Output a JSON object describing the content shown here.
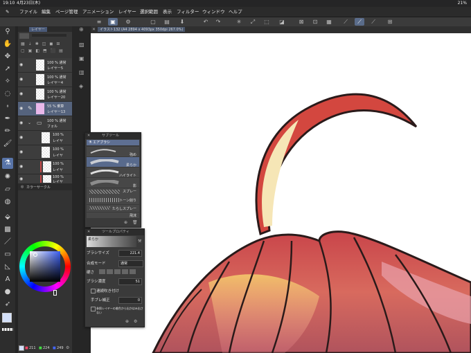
{
  "status": {
    "time": "19:10",
    "date": "4月23日(木)",
    "battery": "21%"
  },
  "menu": [
    "ファイル",
    "編集",
    "ページ管理",
    "アニメーション",
    "レイヤー",
    "選択範囲",
    "表示",
    "フィルター",
    "ウィンドウ",
    "ヘルプ"
  ],
  "canvas_tab": "イラスト132 (A4 2894 x 4093px 350dpi 267.0%)",
  "layer_panel": {
    "tab": "レイヤー",
    "layers": [
      {
        "opacity": "100 % 通常",
        "name": "レイヤー5"
      },
      {
        "opacity": "100 % 通常",
        "name": "レイヤー4"
      },
      {
        "opacity": "100 % 通常",
        "name": "レイヤー20"
      },
      {
        "opacity": "55 % 乗算",
        "name": "レイヤー13"
      },
      {
        "opacity": "100 % 通常",
        "name": "フォル"
      },
      {
        "opacity": "100 %",
        "name": "レイヤ"
      },
      {
        "opacity": "100 %",
        "name": "レイヤ"
      },
      {
        "opacity": "100 %",
        "name": "レイヤ"
      },
      {
        "opacity": "100 %",
        "name": "レイヤ"
      }
    ]
  },
  "color_panel": {
    "tab": "カラーサークル",
    "r": "211",
    "g": "224",
    "b": "249"
  },
  "subtool_panel": {
    "title": "サブツール",
    "group": "エアブラシ",
    "brushes": [
      "強め",
      "柔らか",
      "ハイライト",
      "影",
      "スプレー",
      "トーン削り",
      "たらしスプレー",
      "飛沫"
    ]
  },
  "tool_property": {
    "title": "ツールプロパティ",
    "preset": "柔らか",
    "brush_size_label": "ブラシサイズ",
    "brush_size_value": "221.4",
    "blend_label": "合成モード",
    "blend_value": "通常",
    "hardness_label": "硬さ",
    "density_label": "ブラシ濃度",
    "density_value": "51",
    "continuous_label": "連続吹き付け",
    "stabilize_label": "手ブレ補正",
    "stabilize_value": "0",
    "ref_label": "参照レイヤーの着色から出かはみ出さない"
  }
}
